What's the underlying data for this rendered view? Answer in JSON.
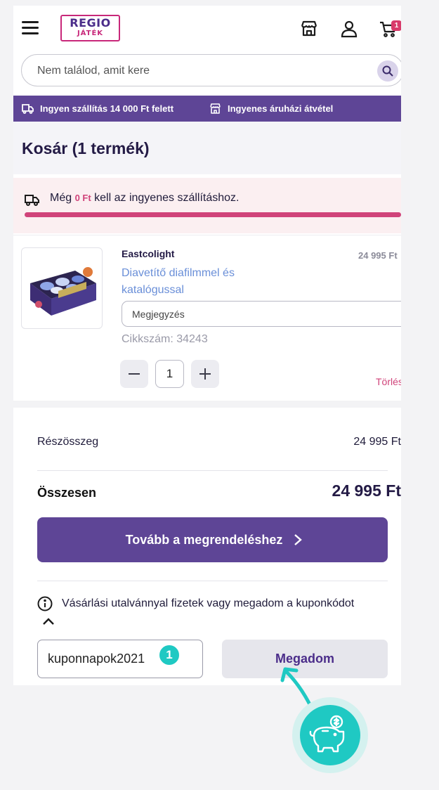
{
  "header": {
    "logo_top": "REGIO",
    "logo_bottom": "JÁTÉK",
    "cart_count": "1"
  },
  "search": {
    "placeholder": "Nem találod, amit kere"
  },
  "promo": {
    "free_shipping": "Ingyen szállítás 14 000 Ft felett",
    "store_pickup": "Ingyenes áruházi átvétel"
  },
  "cart": {
    "title": "Kosár (1 termék)",
    "shipping_prefix": "Még",
    "shipping_amount": "0 Ft",
    "shipping_suffix": "kell az ingyenes szállításhoz.",
    "shipping_progress": 1.0
  },
  "product": {
    "brand": "Eastcolight",
    "name": "Diavetítő diafilmmel és katalógussal",
    "price": "24 995 Ft",
    "note_placeholder": "Megjegyzés",
    "sku": "Cikkszám: 34243",
    "quantity": "1",
    "delete_label": "Törlés"
  },
  "summary": {
    "subtotal_label": "Részösszeg",
    "subtotal_value": "24 995 Ft",
    "total_label": "Összesen",
    "total_value": "24 995 Ft",
    "checkout_label": "Tovább a megrendeléshez",
    "voucher_info": "Vásárlási utalvánnyal fizetek vagy megadom a kuponkódot",
    "coupon_value": "kuponnapok2021",
    "apply_label": "Megadom",
    "step_number": "1"
  },
  "colors": {
    "brand_purple": "#5e4596",
    "accent_pink": "#d0437a",
    "teal": "#1fc9c3"
  },
  "icons": [
    "menu-icon",
    "store-icon",
    "user-icon",
    "cart-icon",
    "search-icon",
    "truck-icon",
    "info-icon",
    "chevron-right-icon",
    "chevron-up-icon",
    "piggy-bank-icon"
  ]
}
